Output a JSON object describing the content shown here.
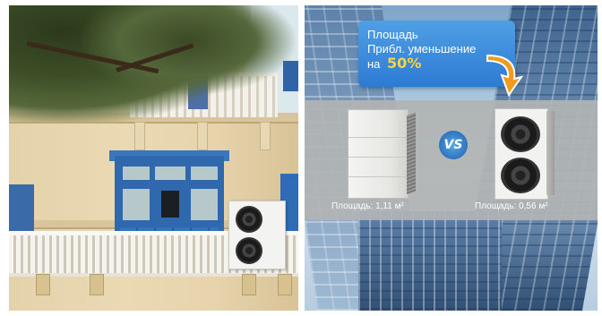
{
  "callout": {
    "line1": "Площадь",
    "line2": "Прибл. уменьшение",
    "line3_prefix": "на",
    "percent": "50%"
  },
  "vs_badge": "VS",
  "captions": {
    "left": "Площадь: 1,11 м²",
    "right": "Площадь: 0,56 м²"
  },
  "colors": {
    "callout_blue": "#2c7bd3",
    "percent_yellow": "#ffd33a",
    "arrow_orange": "#f29a1e",
    "shutter_blue": "#2f68ad"
  }
}
